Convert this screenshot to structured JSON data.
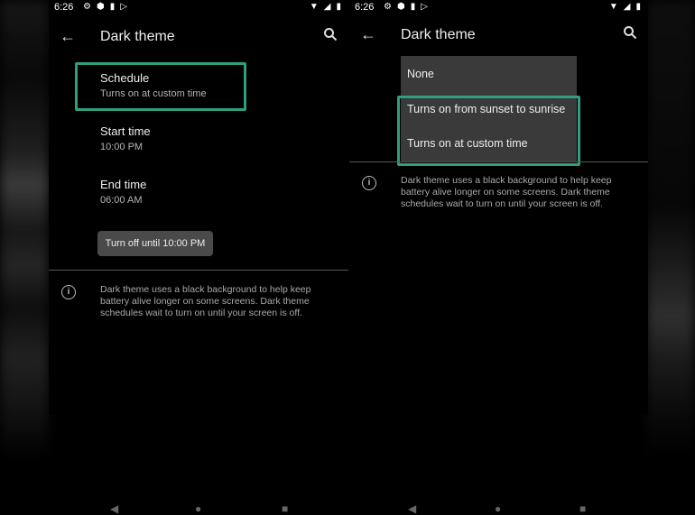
{
  "left": {
    "status": {
      "time": "6:26"
    },
    "appbar": {
      "title": "Dark theme"
    },
    "schedule": {
      "title": "Schedule",
      "subtitle": "Turns on at custom time"
    },
    "start": {
      "title": "Start time",
      "value": "10:00 PM"
    },
    "end": {
      "title": "End time",
      "value": "06:00 AM"
    },
    "action_button": "Turn off until 10:00 PM",
    "info": "Dark theme uses a black background to help keep battery alive longer on some screens. Dark theme schedules wait to turn on until your screen is off."
  },
  "right": {
    "status": {
      "time": "6:26"
    },
    "appbar": {
      "title": "Dark theme"
    },
    "menu": {
      "options": [
        "None",
        "Turns on from sunset to sunrise",
        "Turns on at custom time"
      ]
    },
    "info": "Dark theme uses a black background to help keep battery alive longer on some screens. Dark theme schedules wait to turn on until your screen is off."
  },
  "colors": {
    "highlight": "#2f9f7f",
    "background": "#000000",
    "chip": "#4a4a4a"
  },
  "icons": [
    "back-arrow-icon",
    "search-icon",
    "info-icon",
    "settings-gear-icon",
    "shield-icon",
    "sim-card-icon",
    "play-store-icon",
    "wifi-icon",
    "signal-icon",
    "battery-icon"
  ]
}
